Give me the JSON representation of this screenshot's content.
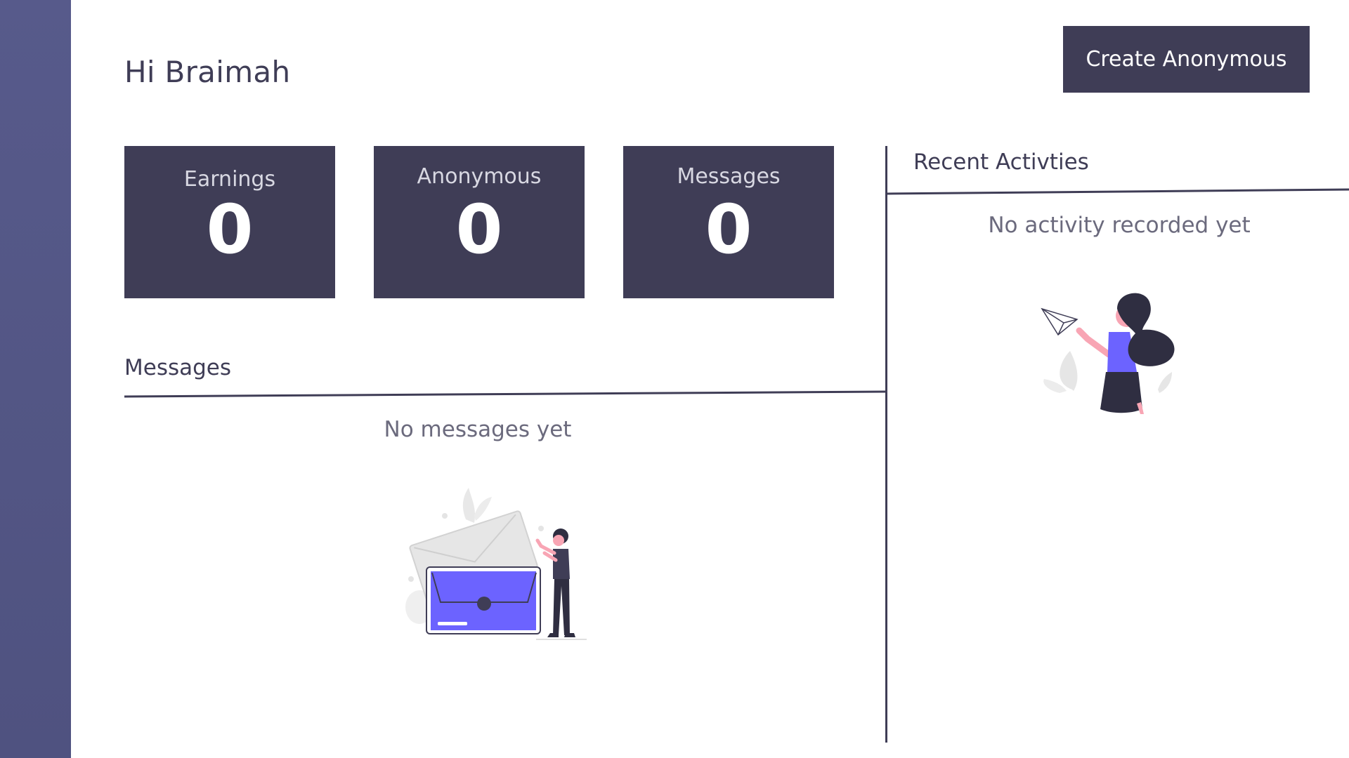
{
  "header": {
    "greeting": "Hi Braimah",
    "create_button_label": "Create Anonymous"
  },
  "stats": [
    {
      "label": "Earnings",
      "value": "0"
    },
    {
      "label": "Anonymous",
      "value": "0"
    },
    {
      "label": "Messages",
      "value": "0"
    }
  ],
  "messages_section": {
    "title": "Messages",
    "empty_text": "No messages yet",
    "illustration": "empty-mailbox-illustration"
  },
  "activity_section": {
    "title": "Recent Activties",
    "empty_text": "No activity recorded yet",
    "illustration": "paper-plane-woman-illustration"
  },
  "colors": {
    "sidebar": "#545786",
    "primary": "#3f3d56",
    "accent": "#6c63ff",
    "skin": "#f8a5b4"
  }
}
